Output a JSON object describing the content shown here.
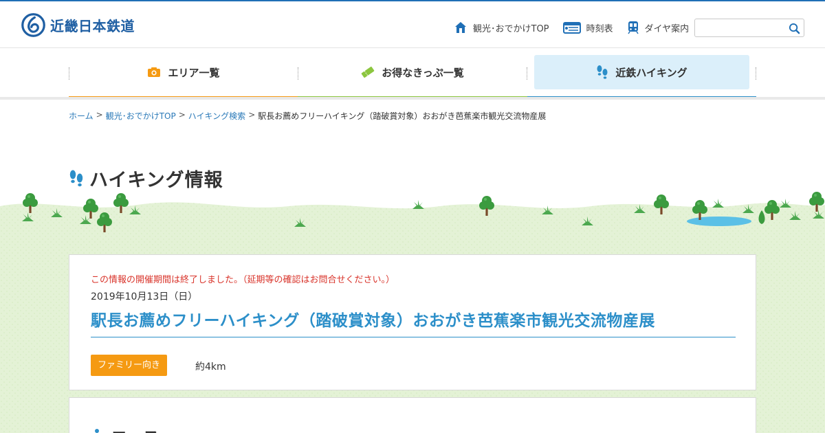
{
  "header": {
    "logo_text": "近畿日本鉄道",
    "links": [
      {
        "label": "観光･おでかけTOP",
        "icon": "house-icon"
      },
      {
        "label": "時刻表",
        "icon": "timetable-icon"
      },
      {
        "label": "ダイヤ案内",
        "icon": "train-icon"
      }
    ],
    "search_placeholder": ""
  },
  "nav": {
    "items": [
      {
        "label": "エリア一覧",
        "icon": "camera-icon",
        "color": "#f59a12"
      },
      {
        "label": "お得なきっぷ一覧",
        "icon": "ticket-icon",
        "color": "#8cc63f"
      },
      {
        "label": "近鉄ハイキング",
        "icon": "footprints-icon",
        "color": "#2c8fc9",
        "active": true
      }
    ]
  },
  "breadcrumb": {
    "links": [
      "ホーム",
      "観光･おでかけTOP",
      "ハイキング検索"
    ],
    "current": "駅長お薦めフリーハイキング（踏破賞対象）おおがき芭蕉楽市観光交流物産展",
    "separator": ">"
  },
  "page": {
    "heading": "ハイキング情報"
  },
  "event": {
    "ended_notice": "この情報の開催期間は終了しました。（延期等の確認はお問合せください。）",
    "date": "2019年10月13日（日）",
    "title": "駅長お薦めフリーハイキング（踏破賞対象）おおがき芭蕉楽市観光交流物産展",
    "badge": "ファミリー向き",
    "distance": "約4km"
  },
  "course": {
    "heading": "コース"
  },
  "colors": {
    "brand_blue": "#1f5fa3",
    "title_blue": "#2c8fc9",
    "notice_red": "#d9342b",
    "badge_orange": "#f59a12",
    "grass": "#e4f2d6"
  }
}
